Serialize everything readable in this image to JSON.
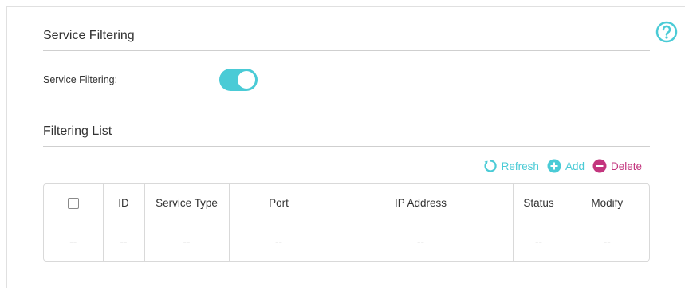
{
  "help_icon": "question-circle-icon",
  "service_filtering": {
    "title": "Service Filtering",
    "field_label": "Service Filtering:",
    "toggle_on": true
  },
  "filtering_list": {
    "title": "Filtering List",
    "toolbar": {
      "refresh_label": "Refresh",
      "add_label": "Add",
      "delete_label": "Delete"
    },
    "columns": [
      "ID",
      "Service Type",
      "Port",
      "IP Address",
      "Status",
      "Modify"
    ],
    "rows": [
      {
        "check": "--",
        "id": "--",
        "service_type": "--",
        "port": "--",
        "ip_address": "--",
        "status": "--",
        "modify": "--"
      }
    ]
  },
  "colors": {
    "accent": "#4acbd6",
    "delete": "#c3357e"
  }
}
